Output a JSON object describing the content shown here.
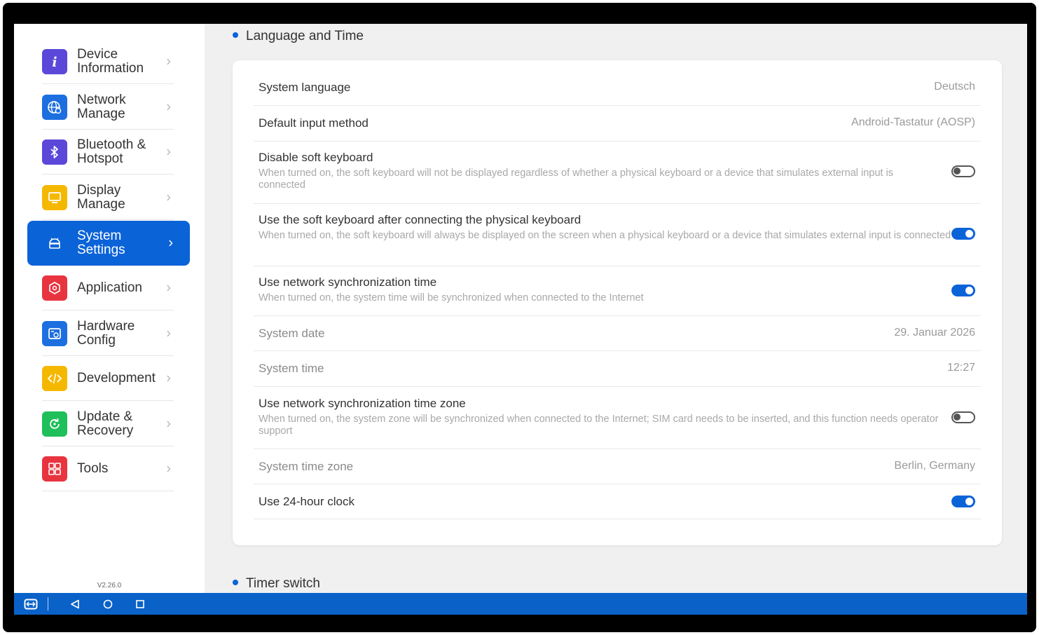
{
  "sidebar": {
    "items": [
      {
        "label": "Device\nInformation",
        "icon": "info-icon",
        "color": "#5b48d9"
      },
      {
        "label": "Network\nManage",
        "icon": "globe-icon",
        "color": "#1d6fe0"
      },
      {
        "label": "Bluetooth &\nHotspot",
        "icon": "bluetooth-icon",
        "color": "#5b48d9"
      },
      {
        "label": "Display\nManage",
        "icon": "display-icon",
        "color": "#f5b800"
      },
      {
        "label": "System\nSettings",
        "icon": "android-icon",
        "color": "#0b63d8"
      },
      {
        "label": "Application",
        "icon": "app-package-icon",
        "color": "#e8343f"
      },
      {
        "label": "Hardware\nConfig",
        "icon": "hardware-icon",
        "color": "#1d6fe0"
      },
      {
        "label": "Development",
        "icon": "code-icon",
        "color": "#f5b800"
      },
      {
        "label": "Update &\nRecovery",
        "icon": "refresh-icon",
        "color": "#1fbf5a"
      },
      {
        "label": "Tools",
        "icon": "grid-icon",
        "color": "#e8343f"
      }
    ],
    "active_index": 4,
    "version": "V2.26.0"
  },
  "sections": {
    "language_time": "Language and Time",
    "timer_switch": "Timer switch"
  },
  "settings": {
    "system_language": {
      "title": "System language",
      "value": "Deutsch"
    },
    "default_input": {
      "title": "Default input method",
      "value": "Android-Tastatur (AOSP)"
    },
    "disable_soft_kb": {
      "title": "Disable soft keyboard",
      "desc": "When turned on, the soft keyboard will not be displayed regardless of whether a physical keyboard or a device that simulates external input is connected",
      "on": false
    },
    "use_soft_kb": {
      "title": "Use the soft keyboard after connecting the physical keyboard",
      "desc": "When turned on, the soft keyboard will always be displayed on the screen when a physical keyboard or a device that simulates external input is connected",
      "on": true
    },
    "net_sync_time": {
      "title": "Use network synchronization time",
      "desc": "When turned on, the system time will be synchronized when connected to the Internet",
      "on": true
    },
    "system_date": {
      "title": "System date",
      "value": "29. Januar 2026"
    },
    "system_time": {
      "title": "System time",
      "value": "12:27"
    },
    "net_sync_zone": {
      "title": "Use network synchronization time zone",
      "desc": "When turned on, the system zone will be synchronized when connected to the Internet; SIM card needs to be inserted, and this function needs operator support",
      "on": false
    },
    "time_zone": {
      "title": "System time zone",
      "value": "Berlin, Germany"
    },
    "clock_24h": {
      "title": "Use 24-hour clock",
      "on": true
    }
  },
  "navbar": {
    "buttons": [
      "screen-share-icon",
      "back-icon",
      "home-icon",
      "recents-icon"
    ],
    "color": "#0a62c9"
  }
}
